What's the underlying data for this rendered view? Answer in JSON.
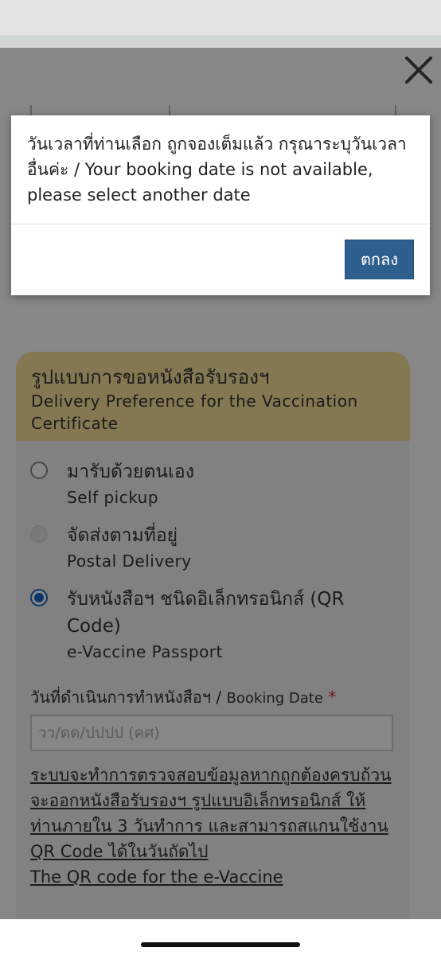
{
  "dialog": {
    "message": "วันเวลาที่ท่านเลือก ถูกจองเต็มแล้ว กรุณาระบุวันเวลาอื่นค่ะ / Your booking date is not available, please select another date",
    "ok_label": "ตกลง"
  },
  "card": {
    "title_th": "รูปแบบการขอหนังสือรับรองฯ",
    "title_en": "Delivery Preference for the Vaccination Certificate",
    "header_color": "#f7e29a"
  },
  "options": [
    {
      "label_th": "มารับด้วยตนเอง",
      "label_en": "Self pickup",
      "state": "unselected"
    },
    {
      "label_th": "จัดส่งตามที่อยู่",
      "label_en": "Postal Delivery",
      "state": "disabled"
    },
    {
      "label_th": "รับหนังสือฯ ชนิดอิเล็กทรอนิกส์ (QR Code)",
      "label_en": "e-Vaccine Passport",
      "state": "selected"
    }
  ],
  "booking": {
    "label_th": "วันที่ดำเนินการทำหนังสือฯ / ",
    "label_en": "Booking Date",
    "required_mark": "*",
    "placeholder": "วว/ดด/ปปปป (คศ)"
  },
  "note": {
    "th": "ระบบจะทำการตรวจสอบข้อมูลหากถูกต้องครบถ้วน จะออกหนังสือรับรองฯ รูปแบบอิเล็กทรอนิกส์ ให้ท่านภายใน 3 วันทำการ และสามารถสแกนใช้งาน QR Code ได้ในวันถัดไป",
    "en": "The QR code for the e-Vaccine"
  },
  "icons": {
    "close": "close-icon"
  },
  "colors": {
    "accent_blue": "#1565c0",
    "ok_button": "#2f5f8f",
    "required": "#d32f2f"
  }
}
